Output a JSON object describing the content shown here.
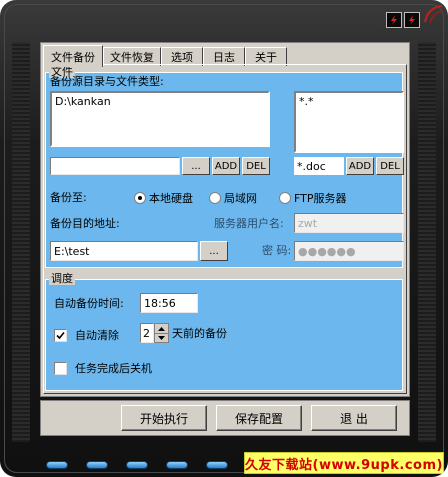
{
  "tabs": [
    {
      "label": "文件备份",
      "active": true
    },
    {
      "label": "文件恢复"
    },
    {
      "label": "选项"
    },
    {
      "label": "日志"
    },
    {
      "label": "关于"
    }
  ],
  "file_group": {
    "title": "文件",
    "source_label": "备份源目录与文件类型:",
    "source_items": [
      "D:\\kankan"
    ],
    "filetype_items": [
      "*.*"
    ],
    "path_input_value": "",
    "browse_label": "...",
    "add_label": "ADD",
    "del_label": "DEL",
    "filetype_input_value": "*.doc",
    "backup_to_label": "备份至:",
    "options": [
      {
        "label": "本地硬盘",
        "selected": true
      },
      {
        "label": "局域网",
        "selected": false
      },
      {
        "label": "FTP服务器",
        "selected": false
      }
    ],
    "dest_label": "备份目的地址:",
    "dest_value": "E:\\test",
    "server_user_label": "服务器用户名:",
    "server_user_value": "zwt",
    "password_label": "密 码:",
    "password_value": "●●●●●●"
  },
  "schedule_group": {
    "title": "调度",
    "auto_time_label": "自动备份时间:",
    "auto_time_value": "18:56",
    "auto_clean_label": "自动清除",
    "auto_clean_checked": true,
    "days_value": "2",
    "days_suffix": "天前的备份",
    "shutdown_label": "任务完成后关机",
    "shutdown_checked": false
  },
  "buttons": {
    "start": "开始执行",
    "save": "保存配置",
    "exit": "退  出"
  },
  "watermark": "久友下载站(www.9upk.com)",
  "colors": {
    "panel_blue": "#6cb8ee",
    "window_gray": "#d4d0c8",
    "frame_dark": "#1c1c1c",
    "accent_red": "#d40000"
  },
  "icons": {
    "minimize": "lightning-minimize-icon",
    "close": "lightning-close-icon",
    "spin_up": "arrow-up-icon",
    "spin_down": "arrow-down-icon",
    "checkmark": "check-icon"
  }
}
